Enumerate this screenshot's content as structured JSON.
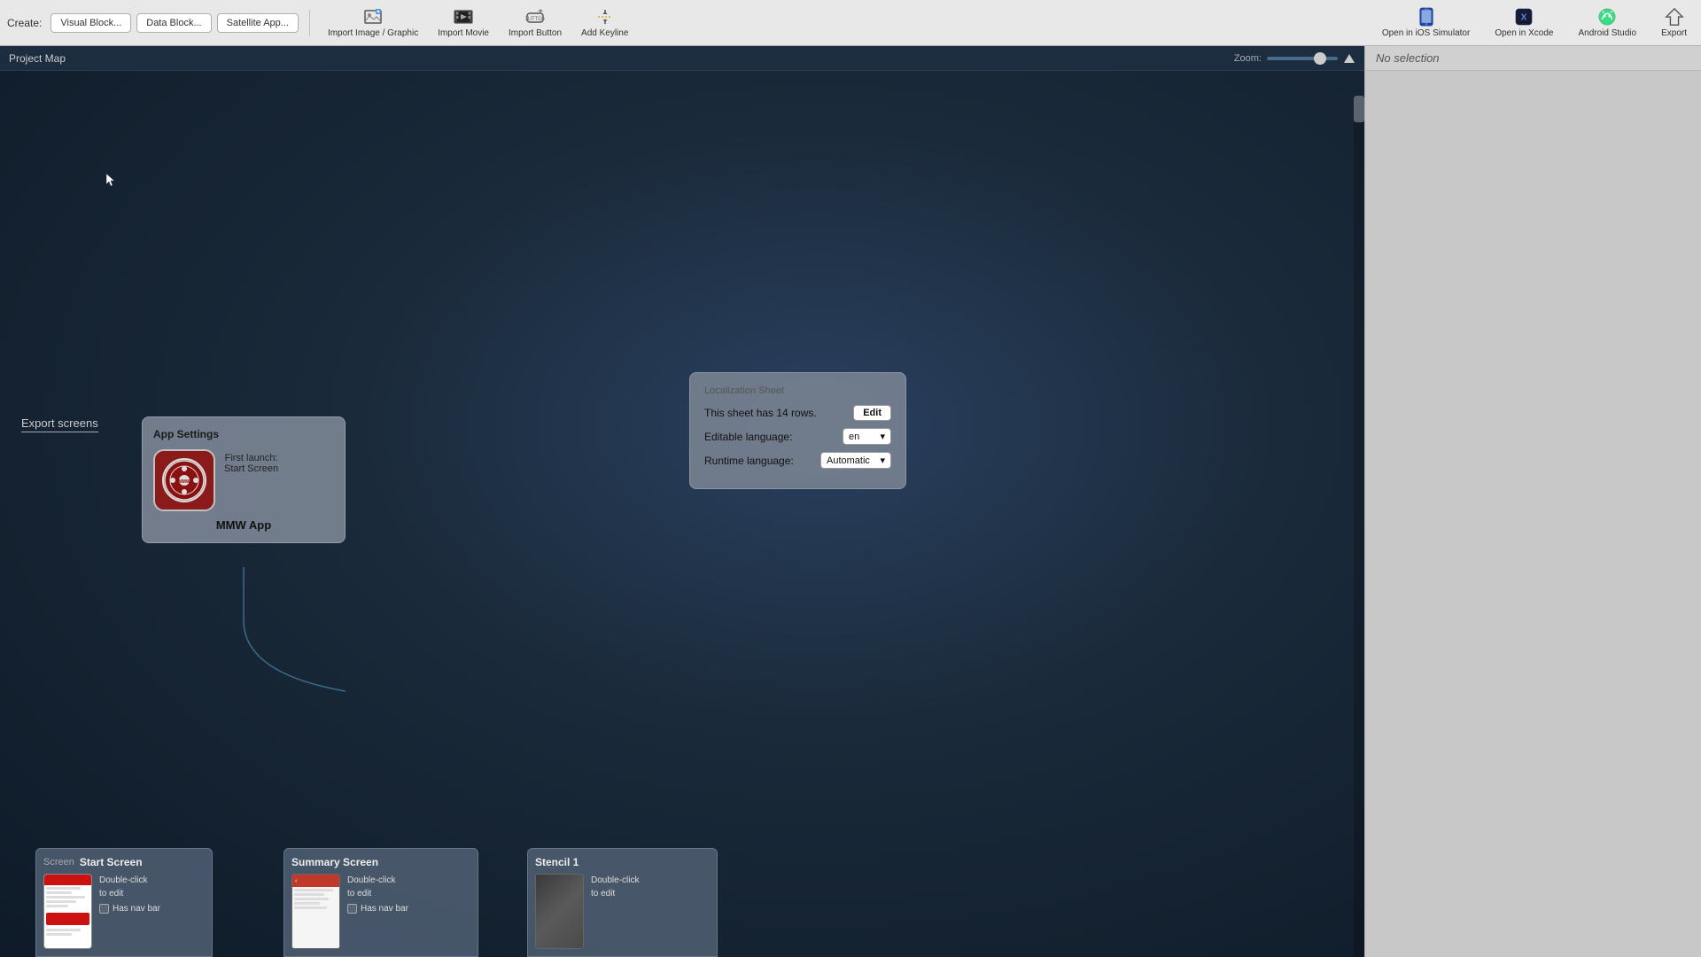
{
  "toolbar": {
    "create_label": "Create:",
    "visual_block_btn": "Visual Block...",
    "data_block_btn": "Data Block...",
    "satellite_app_btn": "Satellite App...",
    "import_image_label": "Import Image / Graphic",
    "import_movie_label": "Import Movie",
    "import_button_label": "Import Button",
    "add_keyline_label": "Add Keyline",
    "open_ios_label": "Open in iOS Simulator",
    "open_xcode_label": "Open in Xcode",
    "android_studio_label": "Android Studio",
    "export_label": "Export"
  },
  "canvas": {
    "title": "Project Map",
    "zoom_label": "Zoom:"
  },
  "right_panel": {
    "no_selection": "No selection"
  },
  "export_screens": {
    "label": "Export screens"
  },
  "app_settings": {
    "title": "App Settings",
    "logo_text": "MITTELDEUTSCHE MOTORENWERKS",
    "first_launch_label": "First launch:",
    "first_launch_value": "Start Screen",
    "app_name": "MMW App"
  },
  "localization": {
    "title": "Localization Sheet",
    "rows_text": "This sheet has 14 rows.",
    "edit_btn": "Edit",
    "editable_lang_label": "Editable language:",
    "editable_lang_value": "en",
    "runtime_lang_label": "Runtime language:",
    "runtime_lang_value": "Automatic"
  },
  "screens": [
    {
      "id": "screen",
      "label": "Screen",
      "title": "Start Screen",
      "info_line1": "Double-click",
      "info_line2": "to edit",
      "has_nav_bar_label": "Has nav bar"
    },
    {
      "id": "summary",
      "label": "",
      "title": "Summary Screen",
      "info_line1": "Double-click",
      "info_line2": "to edit",
      "has_nav_bar_label": "Has nav bar"
    },
    {
      "id": "stencil",
      "label": "",
      "title": "Stencil 1",
      "info_line1": "Double-click",
      "info_line2": "to edit",
      "has_nav_bar_label": ""
    }
  ]
}
